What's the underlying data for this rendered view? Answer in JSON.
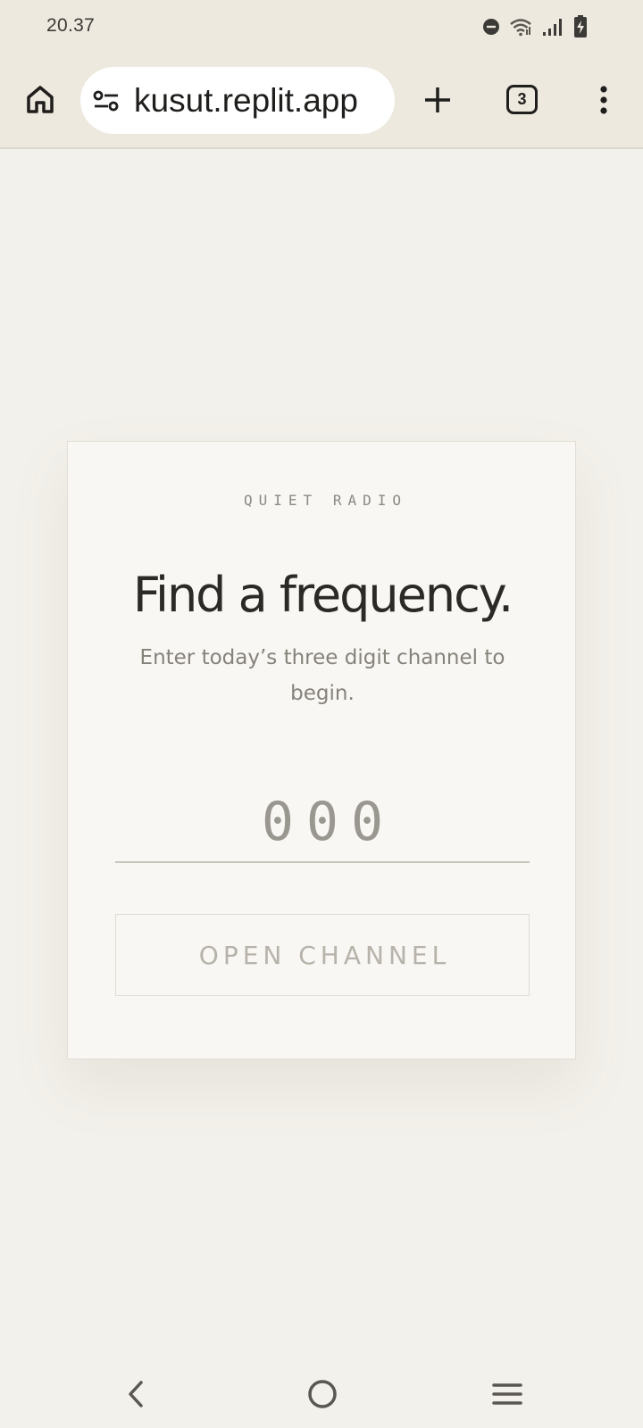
{
  "status_bar": {
    "time": "20.37",
    "icons": [
      "do-not-disturb-icon",
      "wifi-icon",
      "signal-icon",
      "battery-charging-icon"
    ]
  },
  "browser": {
    "url": "kusut.replit.app",
    "tab_count": "3",
    "icons": {
      "home": "home-icon",
      "site_settings": "site-settings-icon",
      "new_tab": "plus-icon",
      "menu": "more-vert-icon"
    }
  },
  "card": {
    "eyebrow": "QUIET RADIO",
    "title": "Find a frequency.",
    "subtitle": "Enter today’s three digit channel to begin.",
    "channel_input": {
      "value": "",
      "placeholder": "000"
    },
    "button_label": "OPEN CHANNEL"
  },
  "nav_bar": {
    "icons": [
      "back-icon",
      "home-circle-icon",
      "recents-icon"
    ]
  },
  "colors": {
    "background": "#f3f1eb",
    "card": "#f8f7f3",
    "title_text": "#2c2a27",
    "muted_text": "#86827b"
  }
}
